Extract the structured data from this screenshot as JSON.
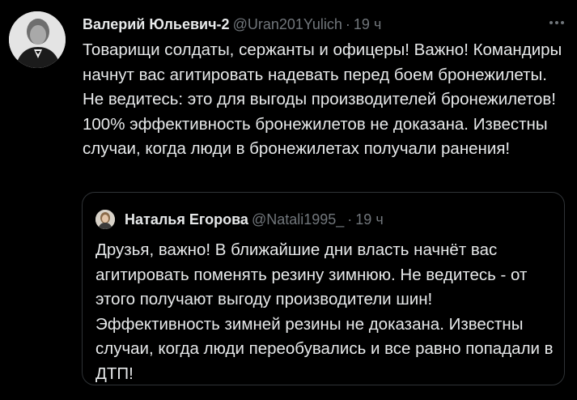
{
  "tweet": {
    "author_name": "Валерий Юльевич-2",
    "author_handle": "@Uran201Yulich",
    "separator": "·",
    "time": "19 ч",
    "text": "Товарищи солдаты, сержанты и офицеры! Важно! Командиры начнут вас агитировать надевать перед боем бронежилеты. Не ведитесь: это для выгоды производителей бронежилетов! 100% эффективность бронежилетов не доказана. Известны случаи, когда люди в бронежилетах получали ранения!",
    "more_icon": "more-horizontal-icon"
  },
  "quoted_tweet": {
    "author_name": "Наталья Егорова",
    "author_handle": "@Natali1995_",
    "separator": "·",
    "time": "19 ч",
    "text": "Друзья, важно! В ближайшие дни власть начнёт вас агитировать поменять резину зимнюю. Не ведитесь - от этого получают выгоду производители шин! Эффективность зимней резины не доказана. Известны случаи, когда люди переобувались и все равно попадали в ДТП!"
  },
  "colors": {
    "background": "#000000",
    "primary_text": "#e7e9ea",
    "secondary_text": "#71767b",
    "border": "#2f3336"
  }
}
